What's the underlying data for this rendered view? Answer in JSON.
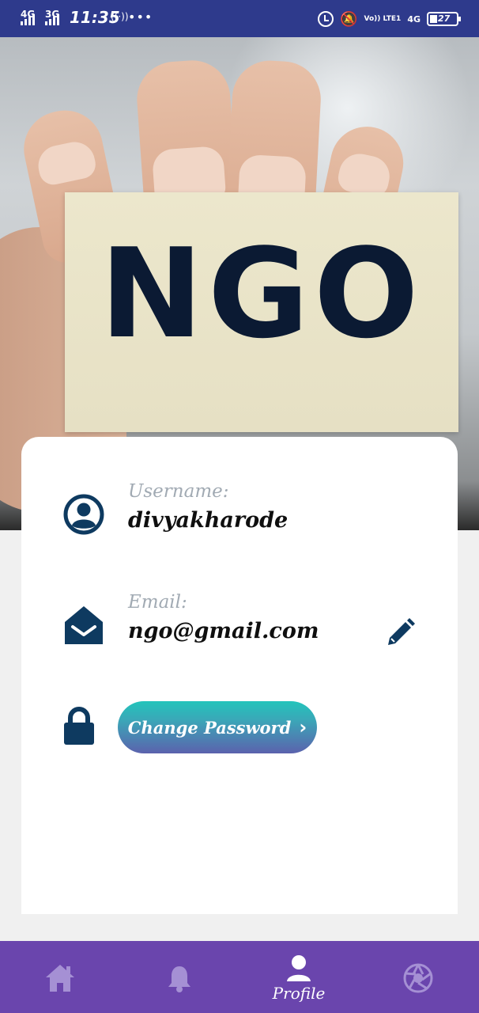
{
  "status_bar": {
    "network_1": "4G",
    "network_2": "3G",
    "time": "11:35",
    "volte": "Vo)) LTE1",
    "network_3": "4G",
    "battery": "27"
  },
  "hero": {
    "card_text": "NGO"
  },
  "profile": {
    "username_label": "Username:",
    "username_value": "divyakharode",
    "email_label": "Email:",
    "email_value": "ngo@gmail.com",
    "change_password_label": "Change Password"
  },
  "bottom_nav": {
    "items": [
      {
        "icon": "home-icon",
        "label": ""
      },
      {
        "icon": "bell-icon",
        "label": ""
      },
      {
        "icon": "profile-icon",
        "label": "Profile",
        "active": true
      },
      {
        "icon": "aperture-icon",
        "label": ""
      }
    ]
  },
  "colors": {
    "status_bar": "#2e3a8c",
    "nav_bar": "#6a45ad",
    "icon_navy": "#0e3a60",
    "nav_inactive_icon": "#a590d4",
    "button_gradient_start": "#22c4bb",
    "button_gradient_end": "#5b62ad"
  }
}
